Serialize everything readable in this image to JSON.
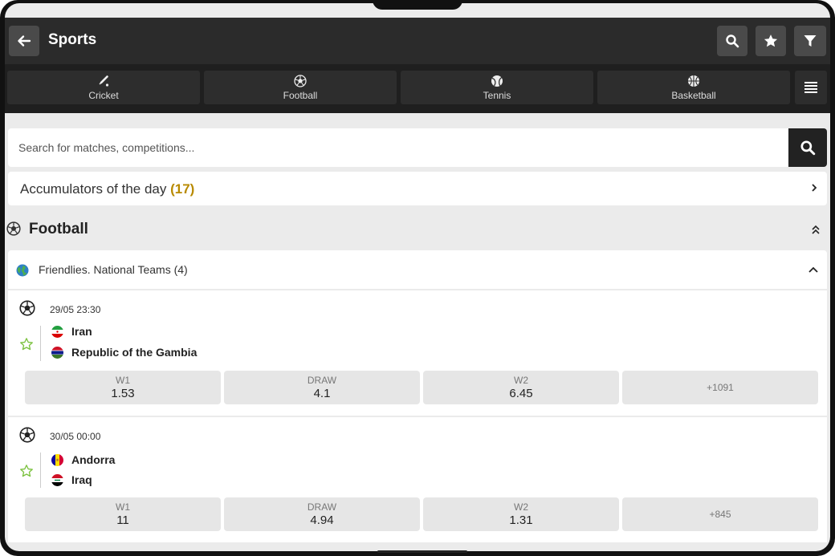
{
  "header": {
    "title": "Sports",
    "icons": [
      "back-arrow-icon",
      "search-icon",
      "star-icon",
      "filter-icon"
    ]
  },
  "tabs": [
    {
      "label": "Cricket",
      "icon": "cricket-bat-icon"
    },
    {
      "label": "Football",
      "icon": "soccer-ball-icon"
    },
    {
      "label": "Tennis",
      "icon": "tennis-ball-icon"
    },
    {
      "label": "Basketball",
      "icon": "basketball-icon"
    }
  ],
  "search": {
    "placeholder": "Search for matches, competitions..."
  },
  "accumulators": {
    "label": "Accumulators of the day",
    "count": "(17)"
  },
  "section": {
    "title": "Football"
  },
  "league": {
    "name": "Friendlies. National Teams (4)"
  },
  "matches": [
    {
      "datetime": "29/05 23:30",
      "team1": "Iran",
      "team2": "Republic of the Gambia",
      "odds": [
        {
          "label": "W1",
          "value": "1.53"
        },
        {
          "label": "DRAW",
          "value": "4.1"
        },
        {
          "label": "W2",
          "value": "6.45"
        }
      ],
      "more": "+1091"
    },
    {
      "datetime": "30/05 00:00",
      "team1": "Andorra",
      "team2": "Iraq",
      "odds": [
        {
          "label": "W1",
          "value": "11"
        },
        {
          "label": "DRAW",
          "value": "4.94"
        },
        {
          "label": "W2",
          "value": "1.31"
        }
      ],
      "more": "+845"
    }
  ],
  "colors": {
    "header": "#2b2b2b",
    "tabs_bg": "#1f1f1f",
    "accent_count": "#b88a00",
    "star": "#7cc240"
  }
}
